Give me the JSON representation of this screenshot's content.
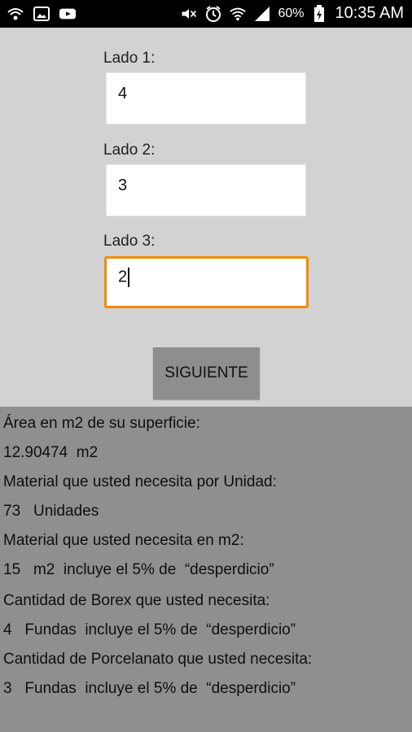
{
  "status_bar": {
    "battery_percent": "60%",
    "time": "10:35 AM",
    "left_icons": [
      "wifi-calling-icon",
      "image-icon",
      "youtube-icon"
    ],
    "right_icons": [
      "mute-icon",
      "alarm-icon",
      "wifi-icon",
      "signal-icon",
      "battery-charging-icon"
    ]
  },
  "form": {
    "lado1_label": "Lado 1:",
    "lado1_value": "4",
    "lado2_label": "Lado 2:",
    "lado2_value": "3",
    "lado3_label": "Lado 3:",
    "lado3_value": "2",
    "next_button": "SIGUIENTE"
  },
  "results": {
    "area_label": "Área en m2 de su superficie:",
    "area_value": "12.90474  m2",
    "units_label": "Material que usted necesita por Unidad:",
    "units_value": "73   Unidades",
    "m2_label": "Material que usted necesita en m2:",
    "m2_value": "15   m2  incluye el 5% de  “desperdicio”",
    "borex_label": "Cantidad de Borex que usted necesita:",
    "borex_value": "4   Fundas  incluye el 5% de  “desperdicio”",
    "porcelanato_label": "Cantidad de Porcelanato que usted necesita:",
    "porcelanato_value": "3   Fundas  incluye el 5% de  “desperdicio”"
  }
}
